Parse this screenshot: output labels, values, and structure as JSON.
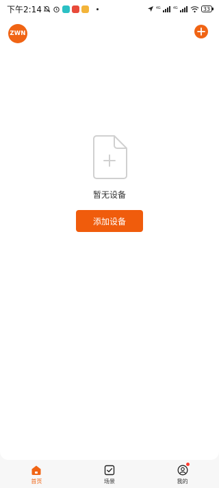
{
  "status_bar": {
    "time": "下午2:14",
    "battery": "33",
    "network_label": "4G"
  },
  "header": {
    "logo_text": "ZWN",
    "add_icon": "plus-icon"
  },
  "empty_state": {
    "icon": "empty-document-add-icon",
    "message": "暂无设备",
    "button_label": "添加设备"
  },
  "bottom_nav": {
    "tabs": [
      {
        "label": "首页",
        "icon": "home-icon",
        "active": true
      },
      {
        "label": "场景",
        "icon": "scene-checkbox-icon",
        "active": false
      },
      {
        "label": "我的",
        "icon": "profile-icon",
        "active": false,
        "badge": true
      }
    ]
  },
  "colors": {
    "accent": "#f06414",
    "background": "#f7f7f7",
    "card": "#ffffff",
    "badge": "#ff3b30"
  }
}
